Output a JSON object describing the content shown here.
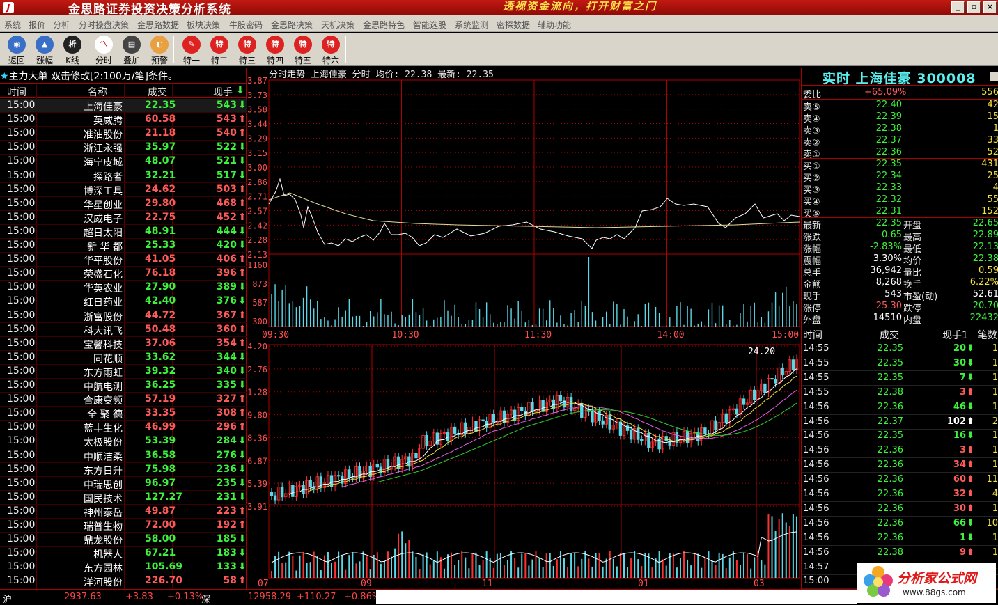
{
  "titlebar": {
    "title": "金思路证券投资决策分析系统",
    "slogan": "透视资金流向，打开财富之门"
  },
  "menu": [
    "系统",
    "报价",
    "分析",
    "分时操盘决策",
    "金思路数据",
    "板块决策",
    "牛股密码",
    "金思路决策",
    "天机决策",
    "金思路特色",
    "智能选股",
    "系统监测",
    "密探数据",
    "辅助功能"
  ],
  "toolbar": {
    "buttons": [
      "返回",
      "涨幅",
      "K线",
      "分时",
      "叠加",
      "预警",
      "特一",
      "特二",
      "特三",
      "特四",
      "特五",
      "特六"
    ]
  },
  "left_panel": {
    "header_prefix": "主力大单",
    "header_rest": "双击修改[2:100万/笔]条件。",
    "columns": [
      "时间",
      "名称",
      "成交",
      "现手"
    ],
    "rows": [
      {
        "time": "15:00",
        "name": "上海佳豪",
        "price": "22.35",
        "vol": "543",
        "dir": "dn"
      },
      {
        "time": "15:00",
        "name": "英威腾",
        "price": "60.58",
        "vol": "543",
        "dir": "up"
      },
      {
        "time": "15:00",
        "name": "准油股份",
        "price": "21.18",
        "vol": "540",
        "dir": "up"
      },
      {
        "time": "15:00",
        "name": "浙江永强",
        "price": "35.97",
        "vol": "522",
        "dir": "dn"
      },
      {
        "time": "15:00",
        "name": "海宁皮城",
        "price": "48.07",
        "vol": "521",
        "dir": "dn"
      },
      {
        "time": "15:00",
        "name": "探路者",
        "price": "32.21",
        "vol": "517",
        "dir": "dn"
      },
      {
        "time": "15:00",
        "name": "博深工具",
        "price": "24.62",
        "vol": "503",
        "dir": "up"
      },
      {
        "time": "15:00",
        "name": "华星创业",
        "price": "29.80",
        "vol": "468",
        "dir": "up"
      },
      {
        "time": "15:00",
        "name": "汉威电子",
        "price": "22.75",
        "vol": "452",
        "dir": "up"
      },
      {
        "time": "15:00",
        "name": "超日太阳",
        "price": "48.91",
        "vol": "444",
        "dir": "dn"
      },
      {
        "time": "15:00",
        "name": "新 华 都",
        "price": "25.33",
        "vol": "420",
        "dir": "dn"
      },
      {
        "time": "15:00",
        "name": "华平股份",
        "price": "41.05",
        "vol": "406",
        "dir": "up"
      },
      {
        "time": "15:00",
        "name": "荣盛石化",
        "price": "76.18",
        "vol": "396",
        "dir": "up"
      },
      {
        "time": "15:00",
        "name": "华英农业",
        "price": "27.90",
        "vol": "389",
        "dir": "dn"
      },
      {
        "time": "15:00",
        "name": "红日药业",
        "price": "42.40",
        "vol": "376",
        "dir": "dn"
      },
      {
        "time": "15:00",
        "name": "浙富股份",
        "price": "44.72",
        "vol": "367",
        "dir": "up"
      },
      {
        "time": "15:00",
        "name": "科大讯飞",
        "price": "50.48",
        "vol": "360",
        "dir": "up"
      },
      {
        "time": "15:00",
        "name": "宝馨科技",
        "price": "37.06",
        "vol": "354",
        "dir": "up"
      },
      {
        "time": "15:00",
        "name": "同花顺",
        "price": "33.62",
        "vol": "344",
        "dir": "dn"
      },
      {
        "time": "15:00",
        "name": "东方雨虹",
        "price": "39.32",
        "vol": "340",
        "dir": "dn"
      },
      {
        "time": "15:00",
        "name": "中航电测",
        "price": "36.25",
        "vol": "335",
        "dir": "dn"
      },
      {
        "time": "15:00",
        "name": "合康变频",
        "price": "57.19",
        "vol": "327",
        "dir": "up"
      },
      {
        "time": "15:00",
        "name": "全 聚 德",
        "price": "33.35",
        "vol": "308",
        "dir": "up"
      },
      {
        "time": "15:00",
        "name": "蓝丰生化",
        "price": "46.99",
        "vol": "296",
        "dir": "up"
      },
      {
        "time": "15:00",
        "name": "太极股份",
        "price": "53.39",
        "vol": "284",
        "dir": "dn"
      },
      {
        "time": "15:00",
        "name": "中顺洁柔",
        "price": "36.58",
        "vol": "276",
        "dir": "dn"
      },
      {
        "time": "15:00",
        "name": "东方日升",
        "price": "75.98",
        "vol": "236",
        "dir": "dn"
      },
      {
        "time": "15:00",
        "name": "中瑞思创",
        "price": "96.97",
        "vol": "235",
        "dir": "dn"
      },
      {
        "time": "15:00",
        "name": "国民技术",
        "price": "127.27",
        "vol": "231",
        "dir": "dn"
      },
      {
        "time": "15:00",
        "name": "神州泰岳",
        "price": "49.87",
        "vol": "223",
        "dir": "up"
      },
      {
        "time": "15:00",
        "name": "瑞普生物",
        "price": "72.00",
        "vol": "192",
        "dir": "up"
      },
      {
        "time": "15:00",
        "name": "鼎龙股份",
        "price": "58.00",
        "vol": "185",
        "dir": "dn"
      },
      {
        "time": "15:00",
        "name": "机器人",
        "price": "67.21",
        "vol": "183",
        "dir": "dn"
      },
      {
        "time": "15:00",
        "name": "东方园林",
        "price": "105.69",
        "vol": "133",
        "dir": "dn"
      },
      {
        "time": "15:00",
        "name": "洋河股份",
        "price": "226.70",
        "vol": "58",
        "dir": "up"
      }
    ]
  },
  "intraday": {
    "header": "分时走势 上海佳豪 分时 均价: 22.38 最新: 22.35",
    "price_ticks": [
      "3.87",
      "3.73",
      "3.58",
      "3.44",
      "3.29",
      "3.15",
      "3.00",
      "2.86",
      "2.71",
      "2.57",
      "2.42",
      "2.28",
      "2.13"
    ],
    "vol_ticks": [
      "1160",
      "873",
      "587",
      "300"
    ],
    "time_labels": [
      "09:30",
      "10:30",
      "11:30",
      "14:00",
      "15:00"
    ],
    "colors": {
      "price_line": "#ffffff",
      "grid": "#b00000",
      "volume": "#5ad8e8"
    }
  },
  "kline": {
    "price_ticks": [
      "4.20",
      "2.76",
      "1.28",
      "9.80",
      "8.36",
      "6.87",
      "5.39",
      "3.91"
    ],
    "high_label": "24.20",
    "date_labels": [
      "07",
      "09",
      "11",
      "01",
      "03"
    ],
    "colors": {
      "up": "#ff3030",
      "down": "#5ad8e8",
      "ma5": "#ffffff",
      "ma10": "#f2e23c",
      "ma20": "#e060e0",
      "ma30": "#30d030"
    }
  },
  "quote": {
    "title": "实时 上海佳豪 300008",
    "weibi": {
      "label": "委比",
      "value": "+65.09%",
      "num": "556"
    },
    "sell": [
      {
        "label": "卖⑤",
        "price": "22.40",
        "vol": "42"
      },
      {
        "label": "卖④",
        "price": "22.39",
        "vol": "15"
      },
      {
        "label": "卖③",
        "price": "22.38",
        "vol": "1"
      },
      {
        "label": "卖②",
        "price": "22.37",
        "vol": "33"
      },
      {
        "label": "卖①",
        "price": "22.36",
        "vol": "52"
      }
    ],
    "buy": [
      {
        "label": "买①",
        "price": "22.35",
        "vol": "431"
      },
      {
        "label": "买②",
        "price": "22.34",
        "vol": "25"
      },
      {
        "label": "买③",
        "price": "22.33",
        "vol": "4"
      },
      {
        "label": "买④",
        "price": "22.32",
        "vol": "55"
      },
      {
        "label": "买⑤",
        "price": "22.31",
        "vol": "152"
      }
    ],
    "stats": [
      {
        "k": "最新",
        "v": "22.35",
        "k2": "开盘",
        "v2": "22.65",
        "c": "g",
        "c2": "g"
      },
      {
        "k": "涨跌",
        "v": "-0.65",
        "k2": "最高",
        "v2": "22.89",
        "c": "g",
        "c2": "g"
      },
      {
        "k": "涨幅",
        "v": "-2.83%",
        "k2": "最低",
        "v2": "22.13",
        "c": "g",
        "c2": "g"
      },
      {
        "k": "震幅",
        "v": "3.30%",
        "k2": "均价",
        "v2": "22.38",
        "c": "w",
        "c2": "g"
      },
      {
        "k": "总手",
        "v": "36,942",
        "k2": "量比",
        "v2": "0.59",
        "c": "w",
        "c2": "y"
      },
      {
        "k": "金额",
        "v": "8,268",
        "k2": "换手",
        "v2": "6.22%",
        "c": "w",
        "c2": "y"
      },
      {
        "k": "现手",
        "v": "543",
        "k2": "市盈(动)",
        "v2": "52.61",
        "c": "w",
        "c2": "w"
      },
      {
        "k": "涨停",
        "v": "25.30",
        "k2": "跌停",
        "v2": "20.70",
        "c": "r",
        "c2": "g"
      },
      {
        "k": "外盘",
        "v": "14510",
        "k2": "内盘",
        "v2": "22432",
        "c": "w",
        "c2": "g"
      }
    ]
  },
  "trades": {
    "columns": [
      "时间",
      "成交",
      "现手1",
      "笔数"
    ],
    "rows": [
      {
        "t": "14:55",
        "p": "22.35",
        "v": "20",
        "d": "dn",
        "b": "1"
      },
      {
        "t": "14:55",
        "p": "22.35",
        "v": "30",
        "d": "dn",
        "b": "1"
      },
      {
        "t": "14:55",
        "p": "22.35",
        "v": "7",
        "d": "dn",
        "b": "1"
      },
      {
        "t": "14:55",
        "p": "22.38",
        "v": "3",
        "d": "up",
        "b": "1"
      },
      {
        "t": "14:56",
        "p": "22.36",
        "v": "46",
        "d": "dn",
        "b": "1"
      },
      {
        "t": "14:56",
        "p": "22.37",
        "v": "102",
        "d": "wt",
        "b": "2"
      },
      {
        "t": "14:56",
        "p": "22.35",
        "v": "16",
        "d": "dn",
        "b": "1"
      },
      {
        "t": "14:56",
        "p": "22.36",
        "v": "3",
        "d": "up",
        "b": "1"
      },
      {
        "t": "14:56",
        "p": "22.36",
        "v": "34",
        "d": "up",
        "b": "1"
      },
      {
        "t": "14:56",
        "p": "22.36",
        "v": "60",
        "d": "up",
        "b": "11"
      },
      {
        "t": "14:56",
        "p": "22.36",
        "v": "32",
        "d": "up",
        "b": "4"
      },
      {
        "t": "14:56",
        "p": "22.36",
        "v": "30",
        "d": "up",
        "b": "1"
      },
      {
        "t": "14:56",
        "p": "22.36",
        "v": "66",
        "d": "dn",
        "b": "10"
      },
      {
        "t": "14:56",
        "p": "22.36",
        "v": "1",
        "d": "dn",
        "b": "1"
      },
      {
        "t": "14:56",
        "p": "22.38",
        "v": "9",
        "d": "up",
        "b": "1"
      },
      {
        "t": "14:57",
        "p": "22.35",
        "v": "151",
        "d": "dn",
        "b": "1"
      },
      {
        "t": "15:00",
        "p": "",
        "v": "",
        "d": "",
        "b": ""
      }
    ]
  },
  "status": {
    "sh_label": "沪",
    "sh_index": "2937.63",
    "sh_chg": "+3.83",
    "sh_pct": "+0.13%",
    "sz_label": "深",
    "sz_index": "12958.29",
    "sz_chg": "+110.27",
    "sz_pct": "+0.86%"
  },
  "watermark": {
    "text": "分析家公式网",
    "url": "www.88gs.com"
  }
}
